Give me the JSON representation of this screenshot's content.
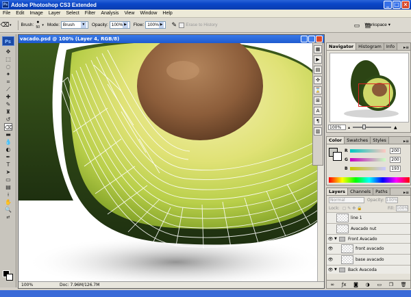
{
  "window": {
    "title": "Adobe Photoshop CS3 Extended",
    "app_icon_text": "Ps"
  },
  "menu": [
    "File",
    "Edit",
    "Image",
    "Layer",
    "Select",
    "Filter",
    "Analysis",
    "View",
    "Window",
    "Help"
  ],
  "options": {
    "brush_label": "Brush:",
    "brush_size": "50",
    "mode_label": "Mode:",
    "mode_value": "Brush",
    "opacity_label": "Opacity:",
    "opacity_value": "100%",
    "flow_label": "Flow:",
    "flow_value": "100%",
    "erase_label": "Erase to History",
    "workspace_label": "Workspace ▾"
  },
  "toolbox": {
    "logo": "Ps"
  },
  "document": {
    "title": "vacado.psd @ 100% (Layer 4, RGB/8)",
    "zoom": "100%",
    "doc_size": "Doc: 7.96M/126.7M"
  },
  "navigator": {
    "tabs": [
      "Navigator",
      "Histogram",
      "Info"
    ],
    "zoom": "100%"
  },
  "color": {
    "tabs": [
      "Color",
      "Swatches",
      "Styles"
    ],
    "channels": [
      {
        "label": "R",
        "value": "200"
      },
      {
        "label": "G",
        "value": "200"
      },
      {
        "label": "B",
        "value": "193"
      }
    ]
  },
  "layers": {
    "tabs": [
      "Layers",
      "Channels",
      "Paths"
    ],
    "blend_mode": "Normal",
    "opacity_label": "Opacity:",
    "opacity_value": "100%",
    "lock_label": "Lock:",
    "fill_label": "Fill:",
    "fill_value": "100%",
    "items": [
      {
        "name": "line 1",
        "type": "layer",
        "visible": false
      },
      {
        "name": "Avacado nut",
        "type": "layer",
        "visible": false
      },
      {
        "name": "Front Avacado",
        "type": "group",
        "visible": true
      },
      {
        "name": "front avacado",
        "type": "layer",
        "visible": true
      },
      {
        "name": "base avacado",
        "type": "layer",
        "visible": true
      },
      {
        "name": "Back Avacoda",
        "type": "group",
        "visible": true
      }
    ]
  },
  "colors": {
    "titlebar": "#0a46c8",
    "avocado_flesh": "#d9e26b",
    "avocado_skin": "#2f4a16",
    "pit": "#8a5a38"
  }
}
